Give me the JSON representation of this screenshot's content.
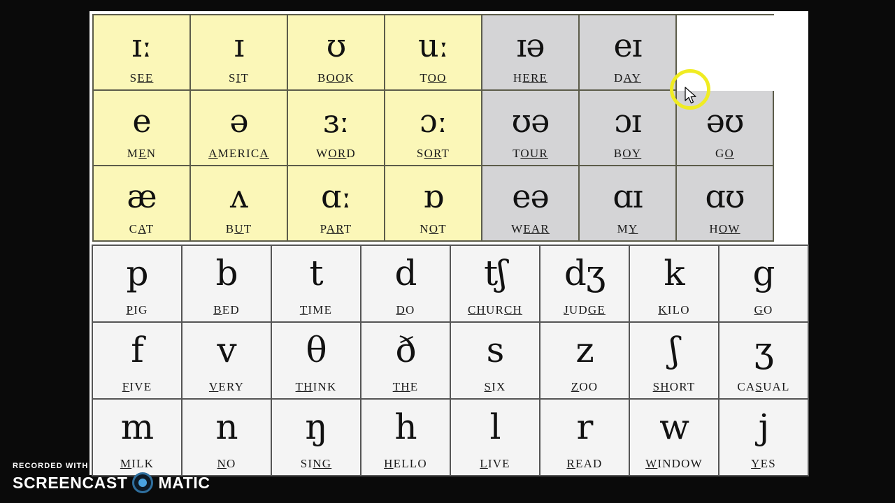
{
  "document": {
    "title": "English Phonemic Chart",
    "colors": {
      "long_short_vowel": "#fbf7b8",
      "diphthong": "#d4d4d6",
      "consonant": "#f4f4f4",
      "border": "#5c5c4a",
      "cursor_highlight": "#f0ec22",
      "page_background": "#0a0a0a",
      "paper": "#ffffff"
    }
  },
  "vowel_rows": [
    [
      {
        "symbol": "ɪː",
        "word": "SEE",
        "word_pre": "S",
        "word_underlined": "EE",
        "word_post": "",
        "fill": "yellow"
      },
      {
        "symbol": "ɪ",
        "word": "SIT",
        "word_pre": "S",
        "word_underlined": "I",
        "word_post": "T",
        "fill": "yellow"
      },
      {
        "symbol": "ʊ",
        "word": "BOOK",
        "word_pre": "B",
        "word_underlined": "OO",
        "word_post": "K",
        "fill": "yellow"
      },
      {
        "symbol": "uː",
        "word": "TOO",
        "word_pre": "T",
        "word_underlined": "OO",
        "word_post": "",
        "fill": "yellow"
      },
      {
        "symbol": "ɪə",
        "word": "HERE",
        "word_pre": "H",
        "word_underlined": "ERE",
        "word_post": "",
        "fill": "gray"
      },
      {
        "symbol": "eɪ",
        "word": "DAY",
        "word_pre": "D",
        "word_underlined": "AY",
        "word_post": "",
        "fill": "gray"
      },
      {
        "symbol": "",
        "word": "",
        "word_pre": "",
        "word_underlined": "",
        "word_post": "",
        "fill": "blank"
      }
    ],
    [
      {
        "symbol": "e",
        "word": "MEN",
        "word_pre": "M",
        "word_underlined": "E",
        "word_post": "N",
        "fill": "yellow"
      },
      {
        "symbol": "ə",
        "word": "AMERICA",
        "word_pre": "",
        "word_underlined": "A",
        "word_post": "MERIC",
        "word_tail": "A",
        "fill": "yellow"
      },
      {
        "symbol": "ɜː",
        "word": "WORD",
        "word_pre": "W",
        "word_underlined": "OR",
        "word_post": "D",
        "fill": "yellow"
      },
      {
        "symbol": "ɔː",
        "word": "SORT",
        "word_pre": "S",
        "word_underlined": "OR",
        "word_post": "T",
        "fill": "yellow"
      },
      {
        "symbol": "ʊə",
        "word": "TOUR",
        "word_pre": "T",
        "word_underlined": "OUR",
        "word_post": "",
        "fill": "gray"
      },
      {
        "symbol": "ɔɪ",
        "word": "BOY",
        "word_pre": "B",
        "word_underlined": "OY",
        "word_post": "",
        "fill": "gray"
      },
      {
        "symbol": "əʊ",
        "word": "GO",
        "word_pre": "G",
        "word_underlined": "O",
        "word_post": "",
        "fill": "gray"
      }
    ],
    [
      {
        "symbol": "æ",
        "word": "CAT",
        "word_pre": "C",
        "word_underlined": "A",
        "word_post": "T",
        "fill": "yellow"
      },
      {
        "symbol": "ʌ",
        "word": "BUT",
        "word_pre": "B",
        "word_underlined": "U",
        "word_post": "T",
        "fill": "yellow"
      },
      {
        "symbol": "ɑː",
        "word": "PART",
        "word_pre": "P",
        "word_underlined": "AR",
        "word_post": "T",
        "fill": "yellow"
      },
      {
        "symbol": "ɒ",
        "word": "NOT",
        "word_pre": "N",
        "word_underlined": "O",
        "word_post": "T",
        "fill": "yellow"
      },
      {
        "symbol": "eə",
        "word": "WEAR",
        "word_pre": "W",
        "word_underlined": "EAR",
        "word_post": "",
        "fill": "gray"
      },
      {
        "symbol": "ɑɪ",
        "word": "MY",
        "word_pre": "M",
        "word_underlined": "Y",
        "word_post": "",
        "fill": "gray"
      },
      {
        "symbol": "ɑʊ",
        "word": "HOW",
        "word_pre": "H",
        "word_underlined": "OW",
        "word_post": "",
        "fill": "gray"
      }
    ]
  ],
  "consonant_rows": [
    [
      {
        "symbol": "p",
        "word": "PIG",
        "word_pre": "",
        "word_underlined": "P",
        "word_post": "IG",
        "fill": "white"
      },
      {
        "symbol": "b",
        "word": "BED",
        "word_pre": "",
        "word_underlined": "B",
        "word_post": "ED",
        "fill": "white"
      },
      {
        "symbol": "t",
        "word": "TIME",
        "word_pre": "",
        "word_underlined": "T",
        "word_post": "IME",
        "fill": "white"
      },
      {
        "symbol": "d",
        "word": "DO",
        "word_pre": "",
        "word_underlined": "D",
        "word_post": "O",
        "fill": "white"
      },
      {
        "symbol": "tʃ",
        "word": "CHURCH",
        "word_pre": "",
        "word_underlined": "CH",
        "word_post": "UR",
        "word_tail": "CH",
        "fill": "white"
      },
      {
        "symbol": "dʒ",
        "word": "JUDGE",
        "word_pre": "",
        "word_underlined": "J",
        "word_post": "UD",
        "word_tail": "GE",
        "fill": "white"
      },
      {
        "symbol": "k",
        "word": "KILO",
        "word_pre": "",
        "word_underlined": "K",
        "word_post": "ILO",
        "fill": "white"
      },
      {
        "symbol": "g",
        "word": "GO",
        "word_pre": "",
        "word_underlined": "G",
        "word_post": "O",
        "fill": "white"
      }
    ],
    [
      {
        "symbol": "f",
        "word": "FIVE",
        "word_pre": "",
        "word_underlined": "F",
        "word_post": "IVE",
        "fill": "white"
      },
      {
        "symbol": "v",
        "word": "VERY",
        "word_pre": "",
        "word_underlined": "V",
        "word_post": "ERY",
        "fill": "white"
      },
      {
        "symbol": "θ",
        "word": "THINK",
        "word_pre": "",
        "word_underlined": "TH",
        "word_post": "INK",
        "fill": "white"
      },
      {
        "symbol": "ð",
        "word": "THE",
        "word_pre": "",
        "word_underlined": "TH",
        "word_post": "E",
        "fill": "white"
      },
      {
        "symbol": "s",
        "word": "SIX",
        "word_pre": "",
        "word_underlined": "S",
        "word_post": "IX",
        "fill": "white"
      },
      {
        "symbol": "z",
        "word": "ZOO",
        "word_pre": "",
        "word_underlined": "Z",
        "word_post": "OO",
        "fill": "white"
      },
      {
        "symbol": "ʃ",
        "word": "SHORT",
        "word_pre": "",
        "word_underlined": "SH",
        "word_post": "ORT",
        "fill": "white"
      },
      {
        "symbol": "ʒ",
        "word": "CASUAL",
        "word_pre": "CA",
        "word_underlined": "S",
        "word_post": "UAL",
        "fill": "white"
      }
    ],
    [
      {
        "symbol": "m",
        "word": "MILK",
        "word_pre": "",
        "word_underlined": "M",
        "word_post": "ILK",
        "fill": "white"
      },
      {
        "symbol": "n",
        "word": "NO",
        "word_pre": "",
        "word_underlined": "N",
        "word_post": "O",
        "fill": "white"
      },
      {
        "symbol": "ŋ",
        "word": "SING",
        "word_pre": "SI",
        "word_underlined": "NG",
        "word_post": "",
        "fill": "white"
      },
      {
        "symbol": "h",
        "word": "HELLO",
        "word_pre": "",
        "word_underlined": "H",
        "word_post": "ELLO",
        "fill": "white"
      },
      {
        "symbol": "l",
        "word": "LIVE",
        "word_pre": "",
        "word_underlined": "L",
        "word_post": "IVE",
        "fill": "white"
      },
      {
        "symbol": "r",
        "word": "READ",
        "word_pre": "",
        "word_underlined": "R",
        "word_post": "EAD",
        "fill": "white"
      },
      {
        "symbol": "w",
        "word": "WINDOW",
        "word_pre": "",
        "word_underlined": "W",
        "word_post": "INDOW",
        "fill": "white"
      },
      {
        "symbol": "j",
        "word": "YES",
        "word_pre": "",
        "word_underlined": "Y",
        "word_post": "ES",
        "fill": "white"
      }
    ]
  ],
  "watermark": {
    "line1": "RECORDED WITH",
    "brand_left": "SCREENCAST",
    "brand_right": "MATIC"
  }
}
